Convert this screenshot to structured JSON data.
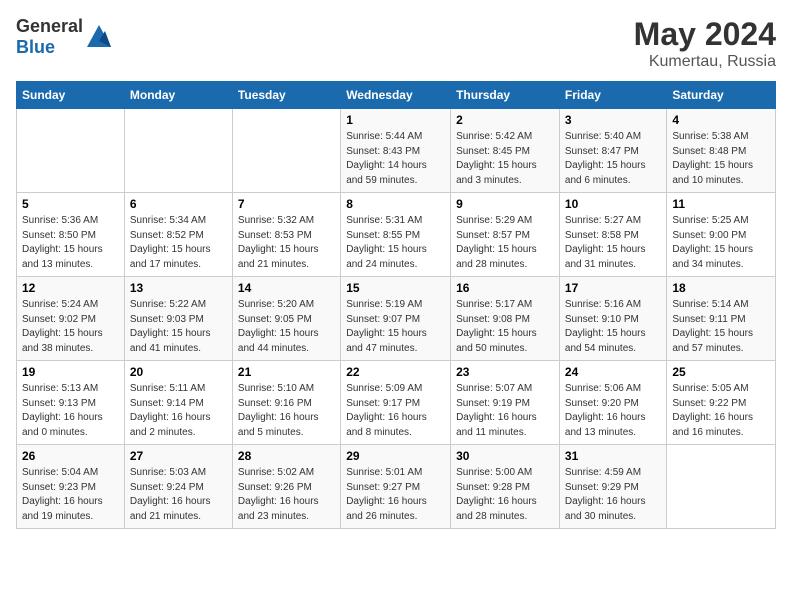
{
  "header": {
    "logo_general": "General",
    "logo_blue": "Blue",
    "month_year": "May 2024",
    "location": "Kumertau, Russia"
  },
  "days_of_week": [
    "Sunday",
    "Monday",
    "Tuesday",
    "Wednesday",
    "Thursday",
    "Friday",
    "Saturday"
  ],
  "weeks": [
    [
      {
        "day": "",
        "info": ""
      },
      {
        "day": "",
        "info": ""
      },
      {
        "day": "",
        "info": ""
      },
      {
        "day": "1",
        "info": "Sunrise: 5:44 AM\nSunset: 8:43 PM\nDaylight: 14 hours\nand 59 minutes."
      },
      {
        "day": "2",
        "info": "Sunrise: 5:42 AM\nSunset: 8:45 PM\nDaylight: 15 hours\nand 3 minutes."
      },
      {
        "day": "3",
        "info": "Sunrise: 5:40 AM\nSunset: 8:47 PM\nDaylight: 15 hours\nand 6 minutes."
      },
      {
        "day": "4",
        "info": "Sunrise: 5:38 AM\nSunset: 8:48 PM\nDaylight: 15 hours\nand 10 minutes."
      }
    ],
    [
      {
        "day": "5",
        "info": "Sunrise: 5:36 AM\nSunset: 8:50 PM\nDaylight: 15 hours\nand 13 minutes."
      },
      {
        "day": "6",
        "info": "Sunrise: 5:34 AM\nSunset: 8:52 PM\nDaylight: 15 hours\nand 17 minutes."
      },
      {
        "day": "7",
        "info": "Sunrise: 5:32 AM\nSunset: 8:53 PM\nDaylight: 15 hours\nand 21 minutes."
      },
      {
        "day": "8",
        "info": "Sunrise: 5:31 AM\nSunset: 8:55 PM\nDaylight: 15 hours\nand 24 minutes."
      },
      {
        "day": "9",
        "info": "Sunrise: 5:29 AM\nSunset: 8:57 PM\nDaylight: 15 hours\nand 28 minutes."
      },
      {
        "day": "10",
        "info": "Sunrise: 5:27 AM\nSunset: 8:58 PM\nDaylight: 15 hours\nand 31 minutes."
      },
      {
        "day": "11",
        "info": "Sunrise: 5:25 AM\nSunset: 9:00 PM\nDaylight: 15 hours\nand 34 minutes."
      }
    ],
    [
      {
        "day": "12",
        "info": "Sunrise: 5:24 AM\nSunset: 9:02 PM\nDaylight: 15 hours\nand 38 minutes."
      },
      {
        "day": "13",
        "info": "Sunrise: 5:22 AM\nSunset: 9:03 PM\nDaylight: 15 hours\nand 41 minutes."
      },
      {
        "day": "14",
        "info": "Sunrise: 5:20 AM\nSunset: 9:05 PM\nDaylight: 15 hours\nand 44 minutes."
      },
      {
        "day": "15",
        "info": "Sunrise: 5:19 AM\nSunset: 9:07 PM\nDaylight: 15 hours\nand 47 minutes."
      },
      {
        "day": "16",
        "info": "Sunrise: 5:17 AM\nSunset: 9:08 PM\nDaylight: 15 hours\nand 50 minutes."
      },
      {
        "day": "17",
        "info": "Sunrise: 5:16 AM\nSunset: 9:10 PM\nDaylight: 15 hours\nand 54 minutes."
      },
      {
        "day": "18",
        "info": "Sunrise: 5:14 AM\nSunset: 9:11 PM\nDaylight: 15 hours\nand 57 minutes."
      }
    ],
    [
      {
        "day": "19",
        "info": "Sunrise: 5:13 AM\nSunset: 9:13 PM\nDaylight: 16 hours\nand 0 minutes."
      },
      {
        "day": "20",
        "info": "Sunrise: 5:11 AM\nSunset: 9:14 PM\nDaylight: 16 hours\nand 2 minutes."
      },
      {
        "day": "21",
        "info": "Sunrise: 5:10 AM\nSunset: 9:16 PM\nDaylight: 16 hours\nand 5 minutes."
      },
      {
        "day": "22",
        "info": "Sunrise: 5:09 AM\nSunset: 9:17 PM\nDaylight: 16 hours\nand 8 minutes."
      },
      {
        "day": "23",
        "info": "Sunrise: 5:07 AM\nSunset: 9:19 PM\nDaylight: 16 hours\nand 11 minutes."
      },
      {
        "day": "24",
        "info": "Sunrise: 5:06 AM\nSunset: 9:20 PM\nDaylight: 16 hours\nand 13 minutes."
      },
      {
        "day": "25",
        "info": "Sunrise: 5:05 AM\nSunset: 9:22 PM\nDaylight: 16 hours\nand 16 minutes."
      }
    ],
    [
      {
        "day": "26",
        "info": "Sunrise: 5:04 AM\nSunset: 9:23 PM\nDaylight: 16 hours\nand 19 minutes."
      },
      {
        "day": "27",
        "info": "Sunrise: 5:03 AM\nSunset: 9:24 PM\nDaylight: 16 hours\nand 21 minutes."
      },
      {
        "day": "28",
        "info": "Sunrise: 5:02 AM\nSunset: 9:26 PM\nDaylight: 16 hours\nand 23 minutes."
      },
      {
        "day": "29",
        "info": "Sunrise: 5:01 AM\nSunset: 9:27 PM\nDaylight: 16 hours\nand 26 minutes."
      },
      {
        "day": "30",
        "info": "Sunrise: 5:00 AM\nSunset: 9:28 PM\nDaylight: 16 hours\nand 28 minutes."
      },
      {
        "day": "31",
        "info": "Sunrise: 4:59 AM\nSunset: 9:29 PM\nDaylight: 16 hours\nand 30 minutes."
      },
      {
        "day": "",
        "info": ""
      }
    ]
  ]
}
